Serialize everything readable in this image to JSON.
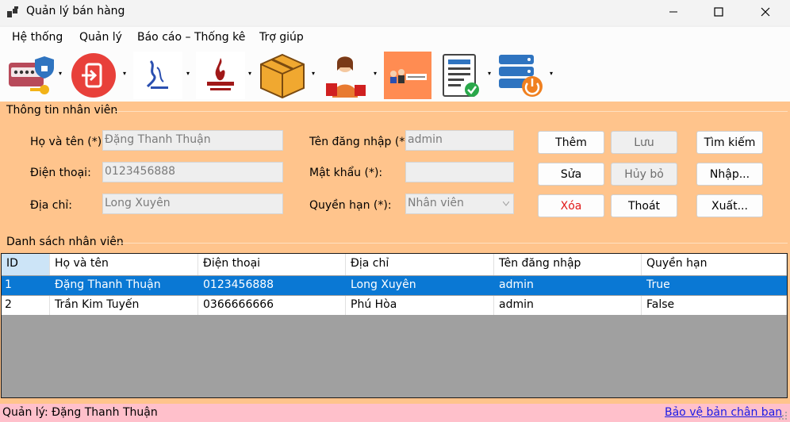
{
  "window": {
    "title": "Quản lý bán hàng",
    "controls": {
      "minimize": "minimize",
      "maximize": "maximize",
      "close": "close"
    }
  },
  "menu": [
    "Hệ thống",
    "Quản lý",
    "Báo cáo – Thống kê",
    "Trợ giúp"
  ],
  "toolbar": {
    "buttons": [
      {
        "icon": "login-password-icon"
      },
      {
        "icon": "logout-icon"
      },
      {
        "icon": "brand-logo-icon"
      },
      {
        "icon": "sneakers-logo-icon"
      },
      {
        "icon": "product-box-icon"
      },
      {
        "icon": "customer-shopping-icon"
      },
      {
        "icon": "staff-management-icon"
      },
      {
        "icon": "invoice-report-icon"
      },
      {
        "icon": "server-power-icon"
      }
    ],
    "colors": {
      "accent_tile": "#ff8c52",
      "red_tile": "#e8403a"
    }
  },
  "employee_info": {
    "group_title": "Thông tin nhân viên",
    "labels": {
      "full_name": "Họ và tên (*):",
      "phone": "Điện thoại:",
      "address": "Địa chỉ:",
      "username": "Tên đăng nhập (*):",
      "password": "Mật khẩu (*):",
      "role": "Quyền hạn (*):"
    },
    "values": {
      "full_name": "Đặng Thanh Thuận",
      "phone": "0123456888",
      "address": "Long Xuyên",
      "username": "admin",
      "password": "",
      "role": "Nhân viên"
    },
    "buttons": {
      "add": "Thêm",
      "save": "Lưu",
      "search": "Tìm kiếm",
      "edit": "Sửa",
      "cancel": "Hủy bỏ",
      "import": "Nhập...",
      "delete": "Xóa",
      "exit": "Thoát",
      "export": "Xuất..."
    }
  },
  "employee_list": {
    "group_title": "Danh sách nhân viên",
    "columns": [
      "ID",
      "Họ và tên",
      "Điện thoại",
      "Địa chỉ",
      "Tên đăng nhập",
      "Quyền hạn"
    ],
    "rows": [
      [
        "1",
        "Đặng Thanh Thuận",
        "0123456888",
        "Long Xuyên",
        "admin",
        "True"
      ],
      [
        "2",
        "Trần Kim Tuyến",
        "0366666666",
        "Phú Hòa",
        "admin",
        "False"
      ]
    ],
    "selected_row": 0
  },
  "status": {
    "user": "Quản lý: Đặng Thanh Thuận",
    "link": "Bảo vệ bản chân ban"
  },
  "colors": {
    "panel": "#ffc48c",
    "status": "#ffc0cb",
    "selection": "#0a78d4",
    "grid_bg": "#a0a0a0"
  }
}
